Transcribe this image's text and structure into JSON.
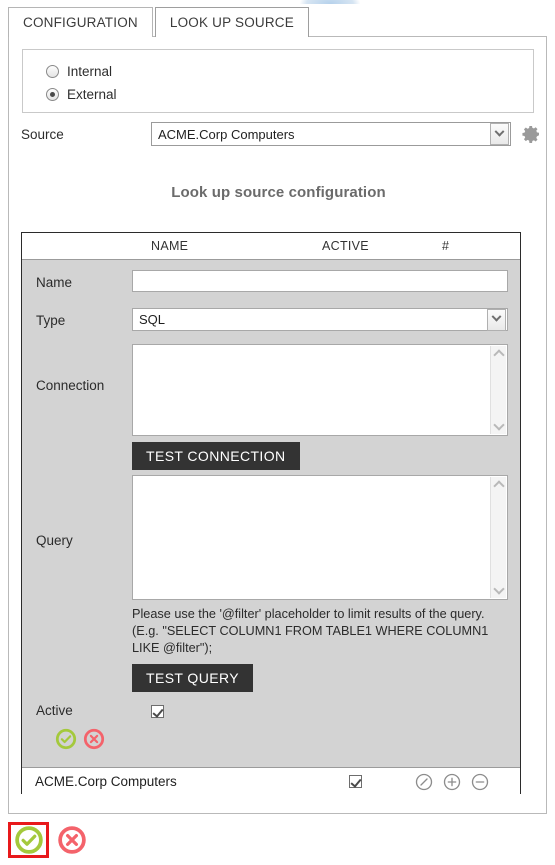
{
  "tabs": [
    {
      "label": "CONFIGURATION",
      "active": false
    },
    {
      "label": "LOOK UP SOURCE",
      "active": true
    }
  ],
  "source_type": {
    "options": [
      {
        "label": "Internal",
        "selected": false
      },
      {
        "label": "External",
        "selected": true
      }
    ]
  },
  "source": {
    "label": "Source",
    "value": "ACME.Corp Computers",
    "settings_icon": "gear-icon",
    "dropdown_icon": "chevron-down-icon"
  },
  "section_title": "Look up source configuration",
  "grid": {
    "columns": [
      "NAME",
      "ACTIVE",
      "#"
    ],
    "rows": [
      {
        "name": "ACME.Corp Computers",
        "active": true,
        "actions": [
          "edit-icon",
          "add-icon",
          "remove-icon"
        ]
      }
    ]
  },
  "editor": {
    "name": {
      "label": "Name",
      "value": "",
      "placeholder": ""
    },
    "type": {
      "label": "Type",
      "value": "SQL",
      "options": [
        "SQL"
      ]
    },
    "connection": {
      "label": "Connection",
      "value": "",
      "placeholder": ""
    },
    "test_connection_button": "TEST CONNECTION",
    "query": {
      "label": "Query",
      "value": "",
      "placeholder": ""
    },
    "query_hint": "Please use the '@filter' placeholder to limit results of the query. (E.g. \"SELECT COLUMN1 FROM TABLE1 WHERE COLUMN1 LIKE @filter\");",
    "test_query_button": "TEST QUERY",
    "active": {
      "label": "Active",
      "checked": true
    },
    "confirm_icon": "check-circle-icon",
    "cancel_icon": "x-circle-icon"
  },
  "bottom_actions": {
    "confirm_icon": "check-circle-icon",
    "cancel_icon": "x-circle-icon",
    "highlighted": "confirm",
    "highlight_color": "#e8191b"
  },
  "colors": {
    "green": "#a4c93c",
    "red": "#f4636b",
    "dark_button": "#333333",
    "editor_background": "#d3d3d3",
    "title_text": "#6b6b6b"
  }
}
